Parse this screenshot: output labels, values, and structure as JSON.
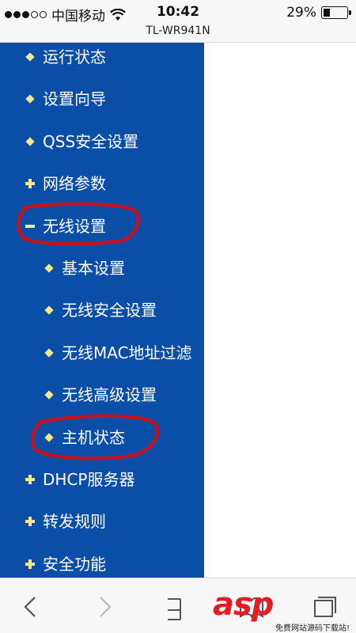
{
  "status_bar": {
    "carrier": "中国移动",
    "time": "10:42",
    "battery_text": "29%",
    "battery_level": 0.29,
    "signal_dots_filled": 3,
    "signal_dots_total": 5,
    "wifi_icon": "wifi-icon"
  },
  "url_bar": {
    "title": "TL-WR941N"
  },
  "menu": {
    "items": [
      {
        "label": "运行状态",
        "icon": "bullet",
        "level": 0,
        "annotated": false
      },
      {
        "label": "设置向导",
        "icon": "bullet",
        "level": 0,
        "annotated": false
      },
      {
        "label": "QSS安全设置",
        "icon": "bullet",
        "level": 0,
        "annotated": false
      },
      {
        "label": "网络参数",
        "icon": "plus",
        "level": 0,
        "annotated": false
      },
      {
        "label": "无线设置",
        "icon": "minus",
        "level": 0,
        "annotated": true
      },
      {
        "label": "基本设置",
        "icon": "bullet",
        "level": 1,
        "annotated": false
      },
      {
        "label": "无线安全设置",
        "icon": "bullet",
        "level": 1,
        "annotated": false
      },
      {
        "label": "无线MAC地址过滤",
        "icon": "bullet",
        "level": 1,
        "annotated": false
      },
      {
        "label": "无线高级设置",
        "icon": "bullet",
        "level": 1,
        "annotated": false
      },
      {
        "label": "主机状态",
        "icon": "bullet",
        "level": 1,
        "annotated": true
      },
      {
        "label": "DHCP服务器",
        "icon": "plus",
        "level": 0,
        "annotated": false
      },
      {
        "label": "转发规则",
        "icon": "plus",
        "level": 0,
        "annotated": false
      },
      {
        "label": "安全功能",
        "icon": "plus",
        "level": 0,
        "annotated": false
      }
    ]
  },
  "toolbar": {
    "back_icon": "chevron-left-icon",
    "forward_icon": "chevron-right-icon",
    "share_icon": "share-icon",
    "bookmarks_icon": "book-icon",
    "tabs_icon": "tabs-icon"
  },
  "watermark": {
    "main_text": "asp",
    "sub_text": "免费网站源码下载站!"
  },
  "colors": {
    "menu_background": "#0a4ea8",
    "menu_text": "#ffffff",
    "bullet": "#f2ea88",
    "annotation": "#c0121e",
    "watermark": "#e61c25"
  }
}
